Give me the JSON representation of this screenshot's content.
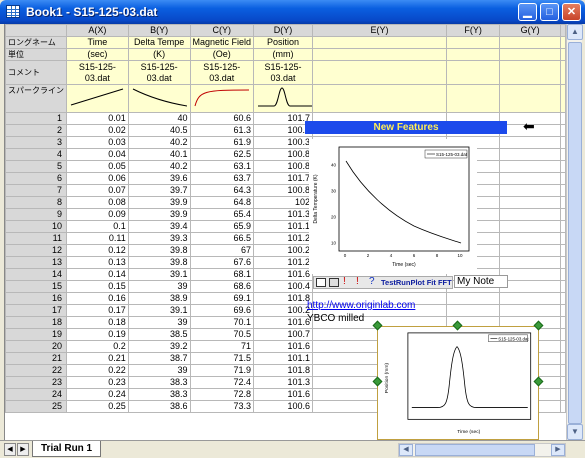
{
  "window": {
    "title": "Book1 - S15-125-03.dat"
  },
  "columns": [
    {
      "id": "A(X)",
      "name": "Time",
      "unit": "(sec)",
      "comment": "S15-125-03.dat"
    },
    {
      "id": "B(Y)",
      "name": "Delta Tempe",
      "unit": "(K)",
      "comment": "S15-125-03.dat"
    },
    {
      "id": "C(Y)",
      "name": "Magnetic Field",
      "unit": "(Oe)",
      "comment": "S15-125-03.dat"
    },
    {
      "id": "D(Y)",
      "name": "Position",
      "unit": "(mm)",
      "comment": "S15-125-03.dat"
    },
    {
      "id": "E(Y)",
      "name": "",
      "unit": "",
      "comment": ""
    },
    {
      "id": "F(Y)",
      "name": "",
      "unit": "",
      "comment": ""
    },
    {
      "id": "G(Y)",
      "name": "",
      "unit": "",
      "comment": ""
    }
  ],
  "row_labels": {
    "long_name": "ロングネーム",
    "unit": "単位",
    "comment": "コメント",
    "sparkline": "スパークライン"
  },
  "rows": [
    [
      "1",
      "0.01",
      "40",
      "60.6",
      "101.7"
    ],
    [
      "2",
      "0.02",
      "40.5",
      "61.3",
      "100.9"
    ],
    [
      "3",
      "0.03",
      "40.2",
      "61.9",
      "100.3"
    ],
    [
      "4",
      "0.04",
      "40.1",
      "62.5",
      "100.8"
    ],
    [
      "5",
      "0.05",
      "40.2",
      "63.1",
      "100.8"
    ],
    [
      "6",
      "0.06",
      "39.6",
      "63.7",
      "101.7"
    ],
    [
      "7",
      "0.07",
      "39.7",
      "64.3",
      "100.8"
    ],
    [
      "8",
      "0.08",
      "39.9",
      "64.8",
      "102"
    ],
    [
      "9",
      "0.09",
      "39.9",
      "65.4",
      "101.3"
    ],
    [
      "10",
      "0.1",
      "39.4",
      "65.9",
      "101.1"
    ],
    [
      "11",
      "0.11",
      "39.3",
      "66.5",
      "101.2"
    ],
    [
      "12",
      "0.12",
      "39.8",
      "67",
      "100.2"
    ],
    [
      "13",
      "0.13",
      "39.8",
      "67.6",
      "101.2"
    ],
    [
      "14",
      "0.14",
      "39.1",
      "68.1",
      "101.6"
    ],
    [
      "15",
      "0.15",
      "39",
      "68.6",
      "100.4"
    ],
    [
      "16",
      "0.16",
      "38.9",
      "69.1",
      "101.8"
    ],
    [
      "17",
      "0.17",
      "39.1",
      "69.6",
      "100.2"
    ],
    [
      "18",
      "0.18",
      "39",
      "70.1",
      "101.6"
    ],
    [
      "19",
      "0.19",
      "38.5",
      "70.5",
      "100.7"
    ],
    [
      "20",
      "0.2",
      "39.2",
      "71",
      "101.6"
    ],
    [
      "21",
      "0.21",
      "38.7",
      "71.5",
      "101.1"
    ],
    [
      "22",
      "0.22",
      "39",
      "71.9",
      "101.8"
    ],
    [
      "23",
      "0.23",
      "38.3",
      "72.4",
      "101.3"
    ],
    [
      "24",
      "0.24",
      "38.3",
      "72.8",
      "101.6"
    ],
    [
      "25",
      "0.25",
      "38.6",
      "73.3",
      "100.6"
    ]
  ],
  "overlays": {
    "new_features": "New Features",
    "toolbar_label": "TestRunPlot Fit FFT",
    "note_label": "My Note",
    "link": "http://www.originlab.com",
    "ybco": "YBCO milled"
  },
  "graph1": {
    "legend": "S15-125-03.dat",
    "ylabel": "Delta Temperature (K)",
    "xlabel": "Time (sec)",
    "x_ticks": [
      "0",
      "2",
      "4",
      "6",
      "8",
      "10"
    ],
    "y_ticks": [
      "10",
      "20",
      "30",
      "40"
    ]
  },
  "graph2": {
    "legend": "S15-125-03.dat",
    "ylabel": "Position (mm)",
    "xlabel": "Time (sec)"
  },
  "sheet_tab": "Trial Run 1",
  "colors": {
    "title_bar": "#0a5fe0",
    "new_features_bg": "#1c4aeb",
    "new_features_fg": "#ffee55",
    "label_bg": "#ffffd0",
    "link": "#0000ee"
  },
  "icons": [
    "book-icon",
    "minimize-icon",
    "maximize-icon",
    "close-icon",
    "left-arrow-icon",
    "scroll-up-icon",
    "scroll-down-icon"
  ]
}
